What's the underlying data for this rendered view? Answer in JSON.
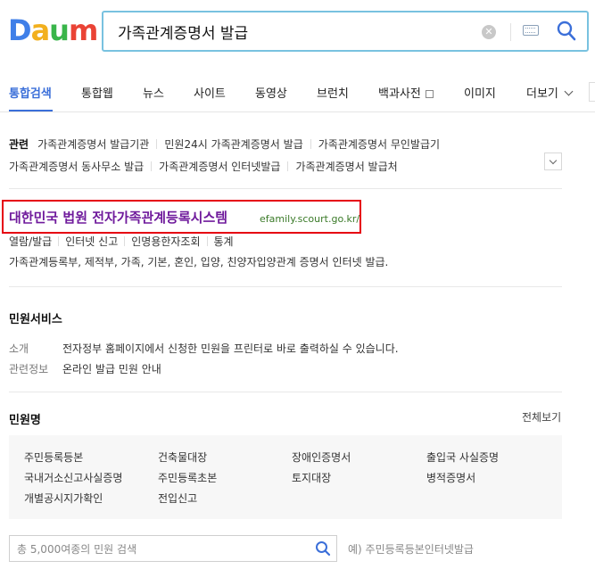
{
  "header": {
    "logo": {
      "letters": [
        "D",
        "a",
        "u",
        "m"
      ],
      "colors": [
        "#3f7fe8",
        "#f2b01e",
        "#39b54a",
        "#ea4335"
      ]
    },
    "search": {
      "value": "가족관계증명서 발급"
    },
    "icons": {
      "clear": "close-circle-icon",
      "keyboard": "keyboard-icon",
      "search": "search-icon"
    }
  },
  "tabs": [
    {
      "label": "통합검색",
      "active": true
    },
    {
      "label": "통합웹"
    },
    {
      "label": "뉴스"
    },
    {
      "label": "사이트"
    },
    {
      "label": "동영상"
    },
    {
      "label": "브런치"
    },
    {
      "label": "백과사전"
    },
    {
      "label": "이미지"
    },
    {
      "label": "더보기"
    }
  ],
  "related": {
    "title": "관련",
    "links": [
      "가족관계증명서 발급기관",
      "민원24시 가족관계증명서 발급",
      "가족관계증명서 무인발급기",
      "가족관계증명서 동사무소 발급",
      "가족관계증명서 인터넷발급",
      "가족관계증명서 발급처"
    ]
  },
  "result": {
    "title": "대한민국 법원 전자가족관계등록시스템",
    "url": "efamily.scourt.go.kr/",
    "sublinks": [
      "열람/발급",
      "인터넷 신고",
      "인명용한자조회",
      "통계"
    ],
    "description": "가족관계등록부, 제적부, 가족, 기본, 혼인, 입양, 친양자입양관계 증명서 인터넷 발급."
  },
  "civil_service": {
    "title": "민원서비스",
    "intro_label": "소개",
    "intro_value": "전자정부 홈페이지에서 신청한 민원을 프린터로 바로 출력하실 수 있습니다.",
    "info_label": "관련정보",
    "info_value": "온라인 발급 민원 안내"
  },
  "civil_names": {
    "title": "민원명",
    "more": "전체보기",
    "items": [
      "주민등록등본",
      "건축물대장",
      "장애인증명서",
      "출입국 사실증명",
      "국내거소신고사실증명",
      "주민등록초본",
      "토지대장",
      "병적증명서",
      "개별공시지가확인",
      "전입신고"
    ],
    "search_placeholder": "총 5,000여종의 민원 검색",
    "example": "예) 주민등록등본인터넷발급"
  }
}
